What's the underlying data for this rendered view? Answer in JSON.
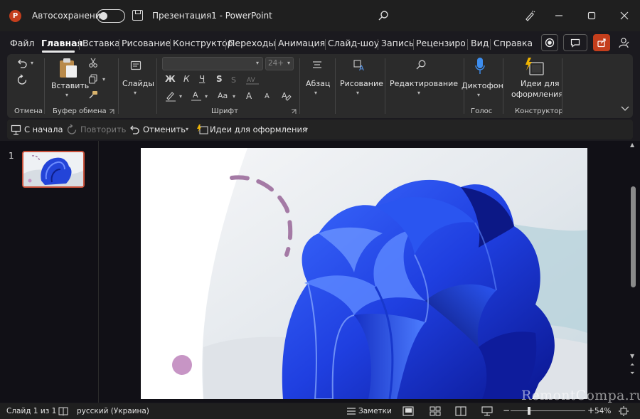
{
  "titlebar": {
    "app_icon_letter": "P",
    "autosave_label": "Автосохранение",
    "document_title": "Презентация1  -  PowerPoint"
  },
  "tabs": [
    {
      "label": "Файл",
      "active": false
    },
    {
      "label": "Главная",
      "active": true
    },
    {
      "label": "Вставка",
      "active": false
    },
    {
      "label": "Рисование",
      "active": false
    },
    {
      "label": "Конструктор",
      "active": false
    },
    {
      "label": "Переходы",
      "active": false
    },
    {
      "label": "Анимация",
      "active": false
    },
    {
      "label": "Слайд-шоу",
      "active": false
    },
    {
      "label": "Запись",
      "active": false
    },
    {
      "label": "Рецензиров",
      "active": false
    },
    {
      "label": "Вид",
      "active": false
    },
    {
      "label": "Справка",
      "active": false
    }
  ],
  "ribbon": {
    "groups": {
      "undo": "Отмена",
      "clipboard": "Буфер обмена",
      "font": "Шрифт",
      "voice": "Голос",
      "designer": "Конструктор"
    },
    "buttons": {
      "paste": "Вставить",
      "slides": "Слайды",
      "paragraph": "Абзац",
      "drawing": "Рисование",
      "editing": "Редактирование",
      "dictate": "Диктофон",
      "design_ideas_line1": "Идеи для",
      "design_ideas_line2": "оформления"
    },
    "font_size_placeholder": "24+",
    "font_glyphs": {
      "bold": "Ж",
      "italic": "К",
      "underline": "Ч",
      "strike": "S",
      "case": "Aa",
      "grow": "A",
      "shrink": "A"
    }
  },
  "qat": {
    "from_start": "С начала",
    "redo": "Повторить",
    "undo": "Отменить",
    "design_ideas": "Идеи для оформления"
  },
  "thumbnail": {
    "number": "1"
  },
  "watermark": "RemontCompa.ru",
  "statusbar": {
    "slide_info": "Слайд 1 из 1",
    "language": "русский (Украина)",
    "notes": "Заметки",
    "zoom": "54%"
  },
  "colors": {
    "accent_powerpoint": "#c43e1c",
    "bloom_blue": "#1f3fe0",
    "decor_purple": "#a47aa5"
  }
}
